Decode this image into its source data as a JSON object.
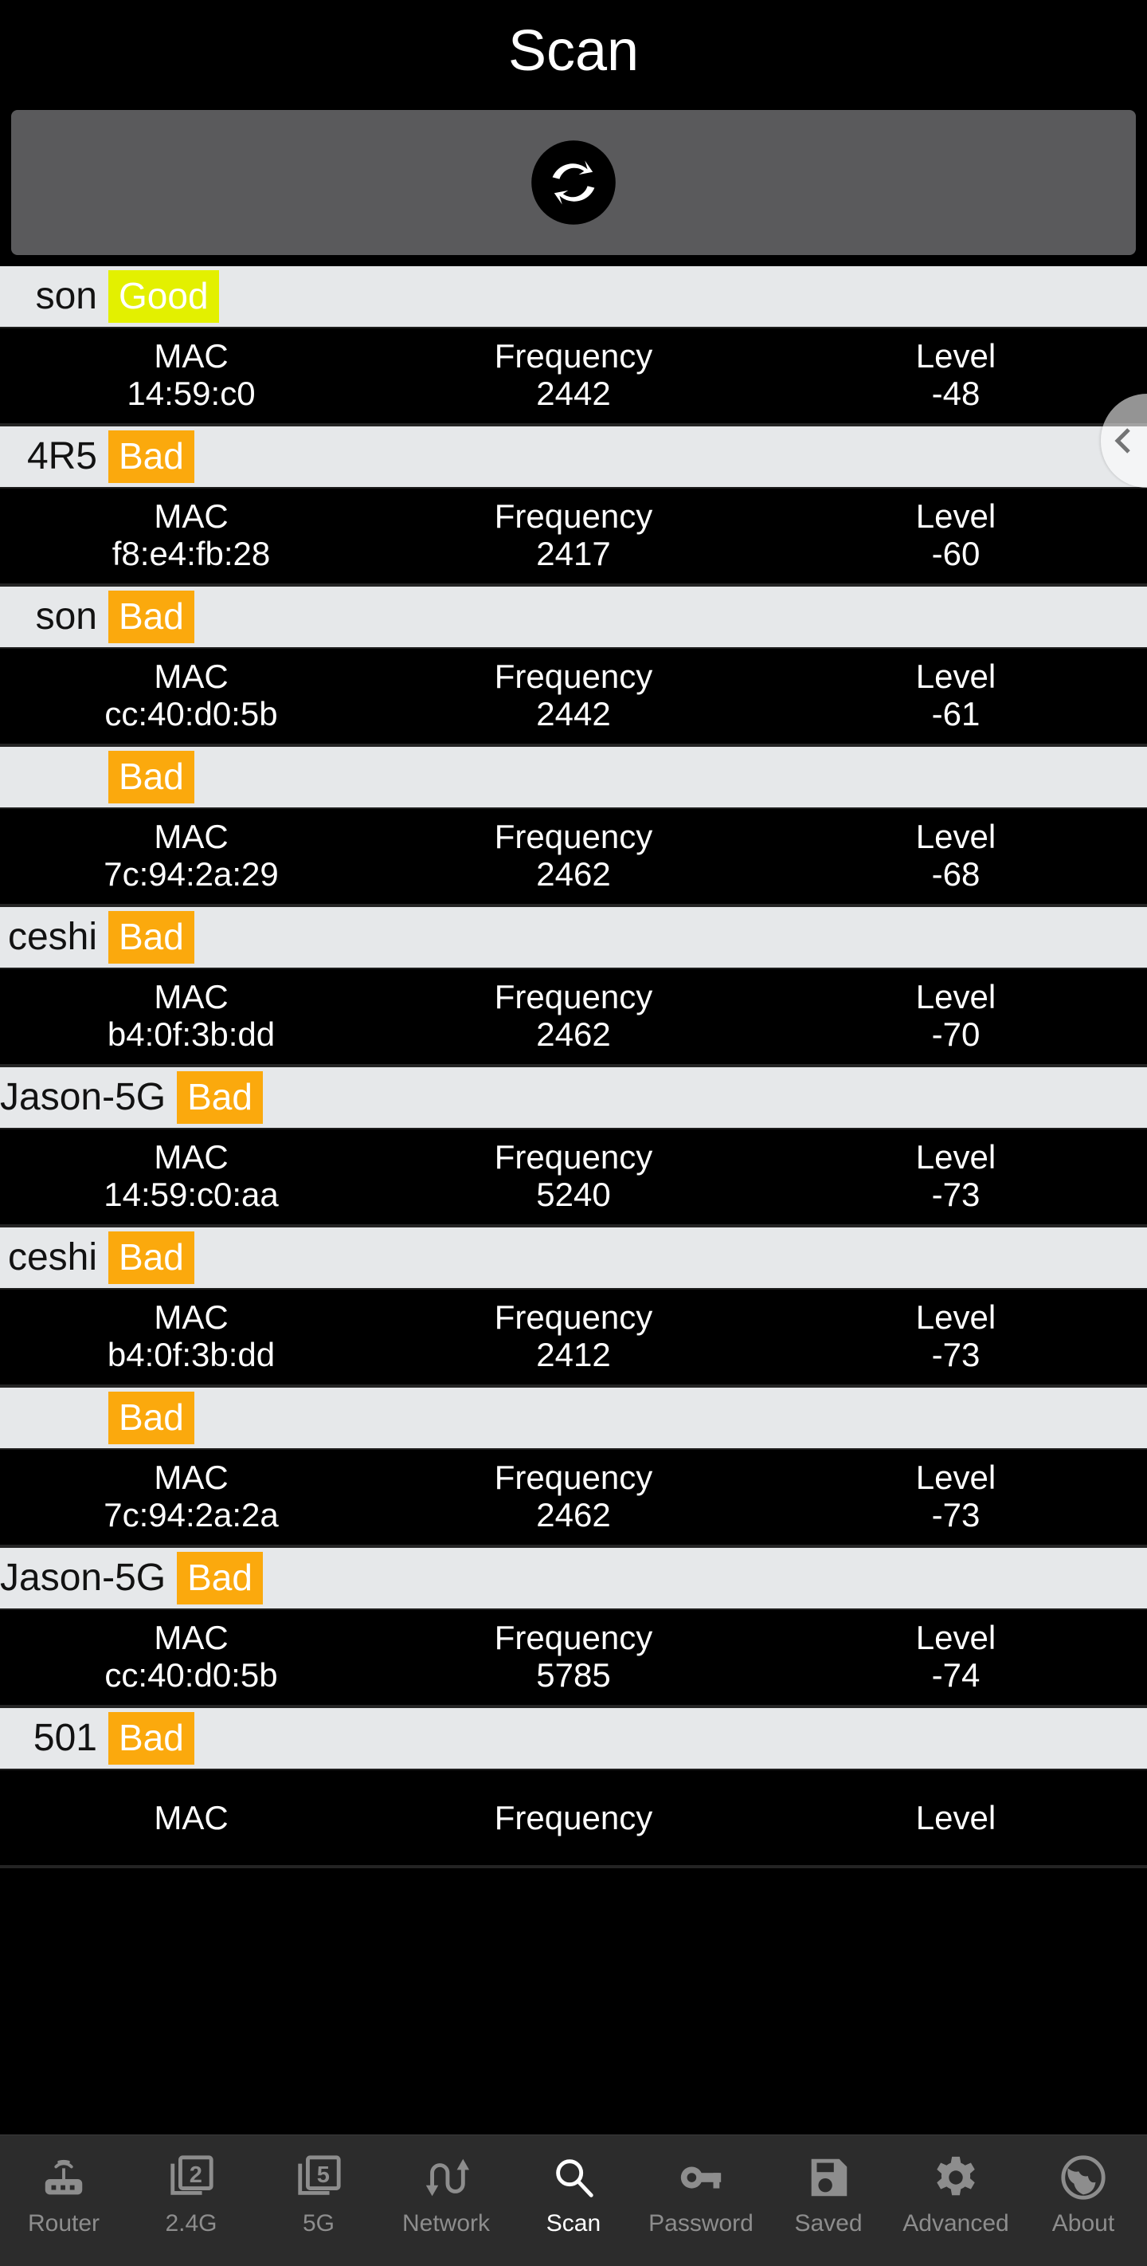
{
  "header": {
    "title": "Scan"
  },
  "toolbar": {
    "refresh_label": "refresh-icon"
  },
  "drawer": {
    "handle_icon": "chevron-left-icon"
  },
  "columns": {
    "mac": "MAC",
    "frequency": "Frequency",
    "level": "Level"
  },
  "badges": {
    "good": "Good",
    "bad": "Bad",
    "good_color": "#e3f000",
    "bad_color": "#fba90d"
  },
  "networks": [
    {
      "ssid": "son",
      "quality": "Good",
      "mac": "14:59:c0",
      "frequency": "2442",
      "level": "-48"
    },
    {
      "ssid": "4R5",
      "quality": "Bad",
      "mac": "f8:e4:fb:28",
      "frequency": "2417",
      "level": "-60"
    },
    {
      "ssid": "son",
      "quality": "Bad",
      "mac": "cc:40:d0:5b",
      "frequency": "2442",
      "level": "-61"
    },
    {
      "ssid": "",
      "quality": "Bad",
      "mac": "7c:94:2a:29",
      "frequency": "2462",
      "level": "-68"
    },
    {
      "ssid": "ceshi",
      "quality": "Bad",
      "mac": "b4:0f:3b:dd",
      "frequency": "2462",
      "level": "-70"
    },
    {
      "ssid": "Jason-5G",
      "quality": "Bad",
      "mac": "14:59:c0:aa",
      "frequency": "5240",
      "level": "-73"
    },
    {
      "ssid": "ceshi",
      "quality": "Bad",
      "mac": "b4:0f:3b:dd",
      "frequency": "2412",
      "level": "-73"
    },
    {
      "ssid": "",
      "quality": "Bad",
      "mac": "7c:94:2a:2a",
      "frequency": "2462",
      "level": "-73"
    },
    {
      "ssid": "Jason-5G",
      "quality": "Bad",
      "mac": "cc:40:d0:5b",
      "frequency": "5785",
      "level": "-74"
    },
    {
      "ssid": "501",
      "quality": "Bad",
      "mac": "",
      "frequency": "",
      "level": ""
    }
  ],
  "bottom_nav": {
    "active": "Scan",
    "items": [
      {
        "label": "Router",
        "icon": "router-icon"
      },
      {
        "label": "2.4G",
        "icon": "band-24g-icon"
      },
      {
        "label": "5G",
        "icon": "band-5g-icon"
      },
      {
        "label": "Network",
        "icon": "transfer-arrows-icon"
      },
      {
        "label": "Scan",
        "icon": "search-icon"
      },
      {
        "label": "Password",
        "icon": "key-icon"
      },
      {
        "label": "Saved",
        "icon": "floppy-disk-icon"
      },
      {
        "label": "Advanced",
        "icon": "gear-icon"
      },
      {
        "label": "About",
        "icon": "globe-icon"
      }
    ]
  }
}
